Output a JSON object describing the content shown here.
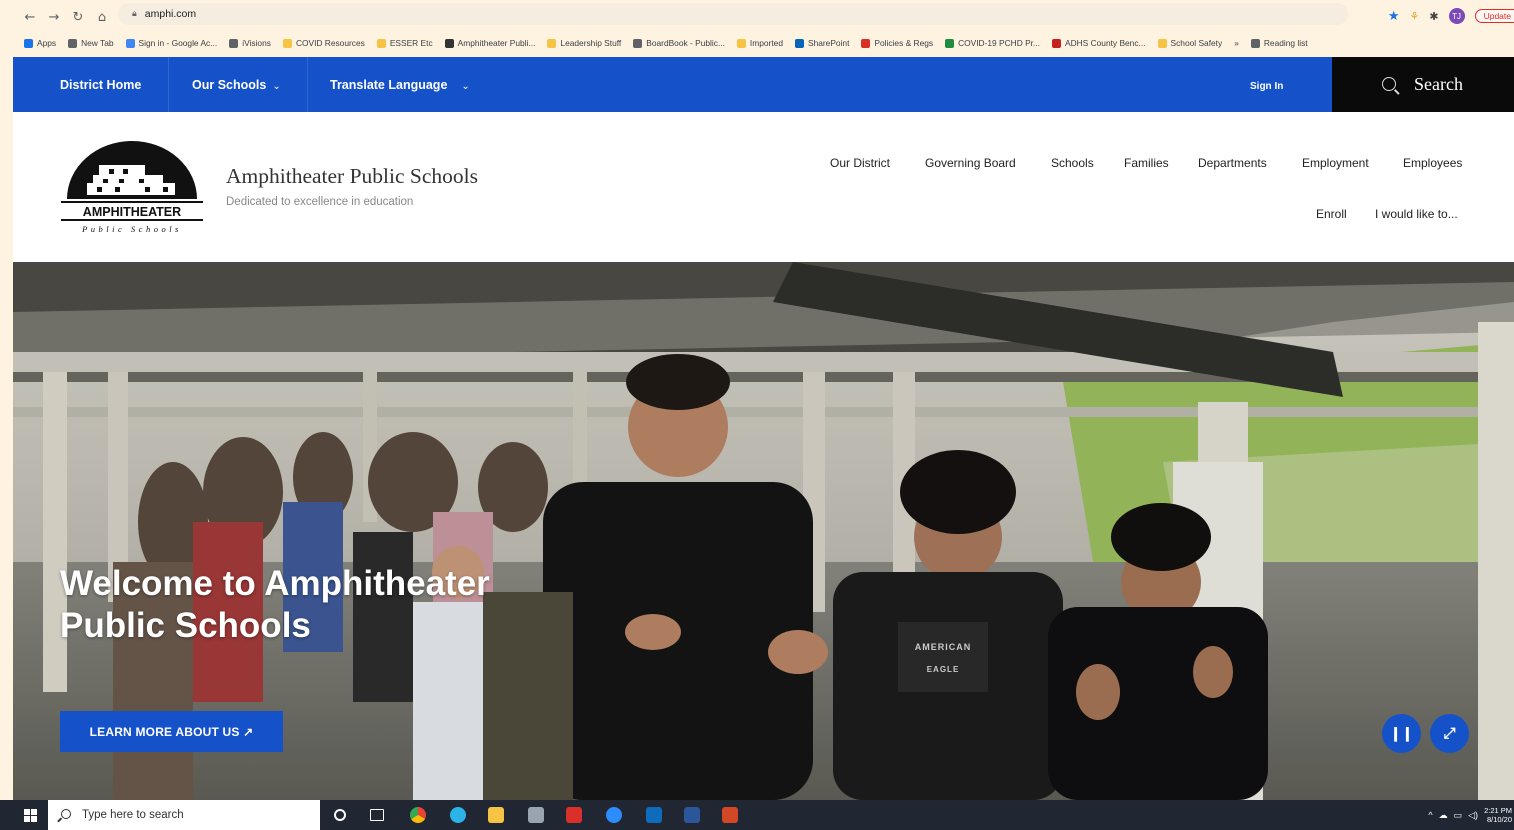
{
  "browser": {
    "url": "amphi.com",
    "update_label": "Update",
    "profile_initials": "TJ",
    "bookmarks": [
      {
        "label": "Apps",
        "color": "#1a73e8"
      },
      {
        "label": "New Tab",
        "color": "#5f6368"
      },
      {
        "label": "Sign in - Google Ac...",
        "color": "#4285f4"
      },
      {
        "label": "iVisions",
        "color": "#5f6368"
      },
      {
        "label": "COVID Resources",
        "color": "#f6c344"
      },
      {
        "label": "ESSER Etc",
        "color": "#f6c344"
      },
      {
        "label": "Amphitheater Publi...",
        "color": "#333333"
      },
      {
        "label": "Leadership Stuff",
        "color": "#f6c344"
      },
      {
        "label": "BoardBook - Public...",
        "color": "#5f6368"
      },
      {
        "label": "Imported",
        "color": "#f6c344"
      },
      {
        "label": "SharePoint",
        "color": "#0364b8"
      },
      {
        "label": "Policies & Regs",
        "color": "#d93025"
      },
      {
        "label": "COVID-19 PCHD Pr...",
        "color": "#1e8e3e"
      },
      {
        "label": "ADHS County Benc...",
        "color": "#c5221f"
      },
      {
        "label": "School Safety",
        "color": "#f6c344"
      },
      {
        "label": "»",
        "color": ""
      },
      {
        "label": "Reading list",
        "color": "#5f6368"
      }
    ]
  },
  "topbar": {
    "district_home": "District Home",
    "our_schools": "Our Schools",
    "translate": "Translate Language",
    "sign_in": "Sign In",
    "search": "Search"
  },
  "header": {
    "logo_text": "AMPHITHEATER",
    "logo_subtext": "Public Schools",
    "title": "Amphitheater Public Schools",
    "tagline": "Dedicated to excellence in education",
    "nav": [
      "Our District",
      "Governing Board",
      "Schools",
      "Families",
      "Departments",
      "Employment",
      "Employees"
    ],
    "subnav": [
      "Enroll",
      "I would like to..."
    ]
  },
  "hero": {
    "title": "Welcome to Amphitheater Public Schools",
    "cta": "LEARN MORE ABOUT US ↗",
    "shirt_text_1": "AMERICAN",
    "shirt_text_2": "EAGLE"
  },
  "taskbar": {
    "search_placeholder": "Type here to search",
    "time": "2:21 PM",
    "date": "8/10/20"
  },
  "colors": {
    "brand_blue": "#1552c9",
    "search_black": "#0a0a0a",
    "taskbar": "#202733"
  }
}
